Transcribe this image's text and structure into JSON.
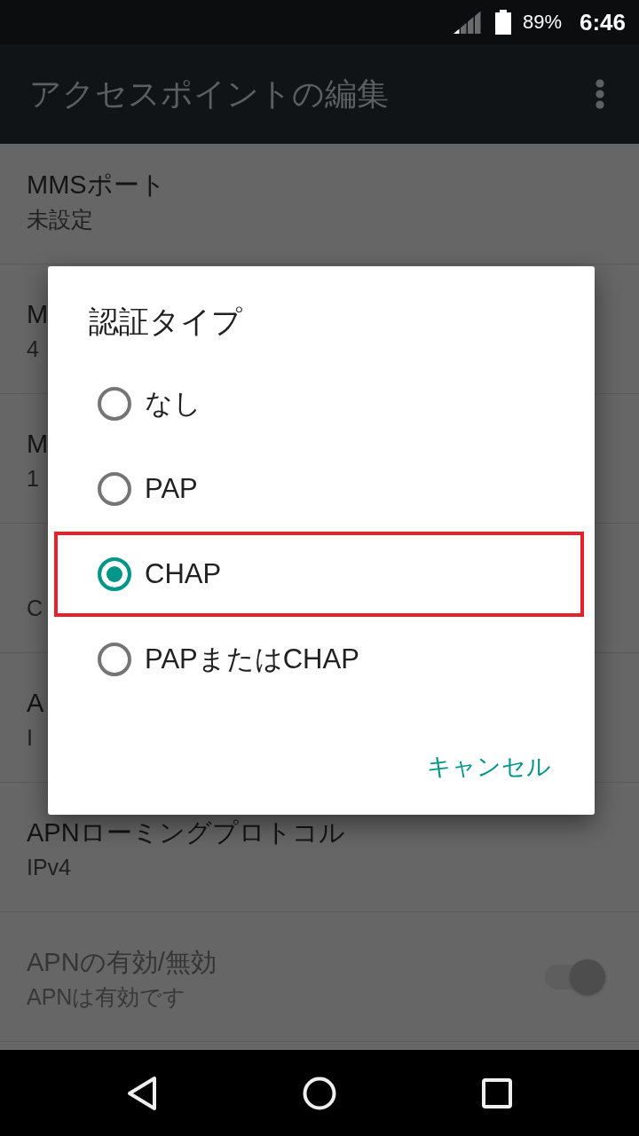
{
  "status_bar": {
    "battery": "89%",
    "time": "6:46"
  },
  "app_bar": {
    "title": "アクセスポイントの編集"
  },
  "settings": [
    {
      "kind": "text",
      "title": "MMSポート",
      "summary": "未設定",
      "disabled": false
    },
    {
      "kind": "text",
      "title": "M",
      "summary": "4",
      "disabled": false
    },
    {
      "kind": "text",
      "title": "M",
      "summary": "1",
      "disabled": false
    },
    {
      "kind": "text",
      "summary": "C",
      "disabled": false
    },
    {
      "kind": "text",
      "title": "A",
      "summary": "I",
      "disabled": false
    },
    {
      "kind": "text",
      "title": "APNローミングプロトコル",
      "summary": "IPv4",
      "disabled": false
    },
    {
      "kind": "switch",
      "title": "APNの有効/無効",
      "summary": "APNは有効です",
      "disabled": true,
      "on": true
    }
  ],
  "dialog": {
    "title": "認証タイプ",
    "options": [
      {
        "label": "なし",
        "selected": false,
        "highlighted": false
      },
      {
        "label": "PAP",
        "selected": false,
        "highlighted": false
      },
      {
        "label": "CHAP",
        "selected": true,
        "highlighted": true
      },
      {
        "label": "PAPまたはCHAP",
        "selected": false,
        "highlighted": false
      }
    ],
    "buttons": [
      "キャンセル"
    ]
  }
}
